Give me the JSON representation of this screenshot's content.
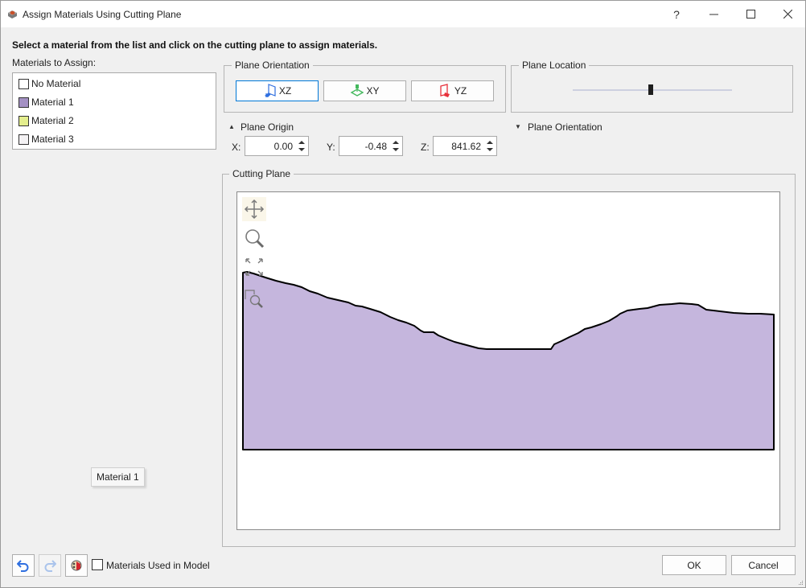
{
  "window": {
    "title": "Assign Materials Using Cutting Plane",
    "controls": {
      "help": "?",
      "minimize": "—",
      "maximize": "☐",
      "close": "✕"
    }
  },
  "instructions": "Select a material from the list and click on the cutting plane to assign materials.",
  "materials": {
    "label": "Materials to Assign:",
    "items": [
      {
        "name": "No Material",
        "color": "#ffffff"
      },
      {
        "name": "Material 1",
        "color": "#a491c4"
      },
      {
        "name": "Material 2",
        "color": "#e4ee8e"
      },
      {
        "name": "Material 3",
        "color": "#f4f2f4"
      }
    ]
  },
  "plane_orientation": {
    "title": "Plane Orientation",
    "buttons": [
      {
        "label": "XZ",
        "icon": "xz-plane-icon",
        "color": "#2f6fe0",
        "selected": true
      },
      {
        "label": "XY",
        "icon": "xy-plane-icon",
        "color": "#42b85c",
        "selected": false
      },
      {
        "label": "YZ",
        "icon": "yz-plane-icon",
        "color": "#e8303a",
        "selected": false
      }
    ]
  },
  "plane_location": {
    "title": "Plane Location",
    "slider_value_fraction": 0.49
  },
  "plane_origin": {
    "title": "Plane Origin",
    "x_label": "X:",
    "x_value": "0.00",
    "y_label": "Y:",
    "y_value": "-0.48",
    "z_label": "Z:",
    "z_value": "841.62"
  },
  "plane_orientation_collapsed": {
    "title": "Plane Orientation"
  },
  "cutting_plane": {
    "title": "Cutting Plane",
    "tools": [
      "pan-icon",
      "zoom-icon",
      "zoom-extents-icon",
      "zoom-window-icon"
    ],
    "fill_color": "#c5b6dd",
    "outline_color": "#000000"
  },
  "tooltip": "Material 1",
  "footer": {
    "materials_used_label": "Materials Used in Model",
    "materials_used_checked": false,
    "ok": "OK",
    "cancel": "Cancel"
  }
}
